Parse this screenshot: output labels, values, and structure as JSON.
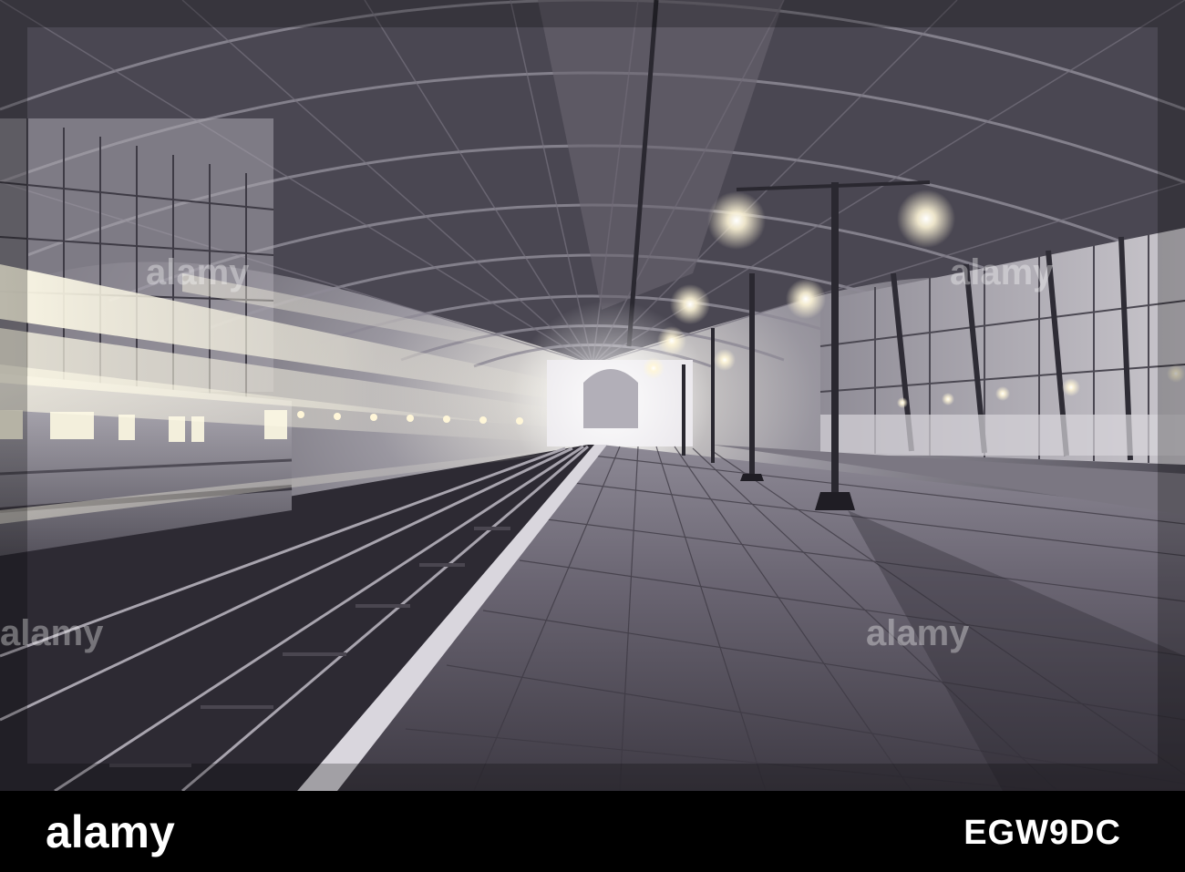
{
  "footer": {
    "logo_text": "alamy",
    "image_id": "EGW9DC",
    "background": "#000000",
    "text_color": "#ffffff"
  },
  "photo": {
    "watermark_text": "alamy",
    "tone": "sepia-toned grey, cool shadows"
  },
  "colors": {
    "lamp_glow": "#fff6d8",
    "roof_steel": "#3a3840",
    "platform_brick": "#615c66"
  }
}
